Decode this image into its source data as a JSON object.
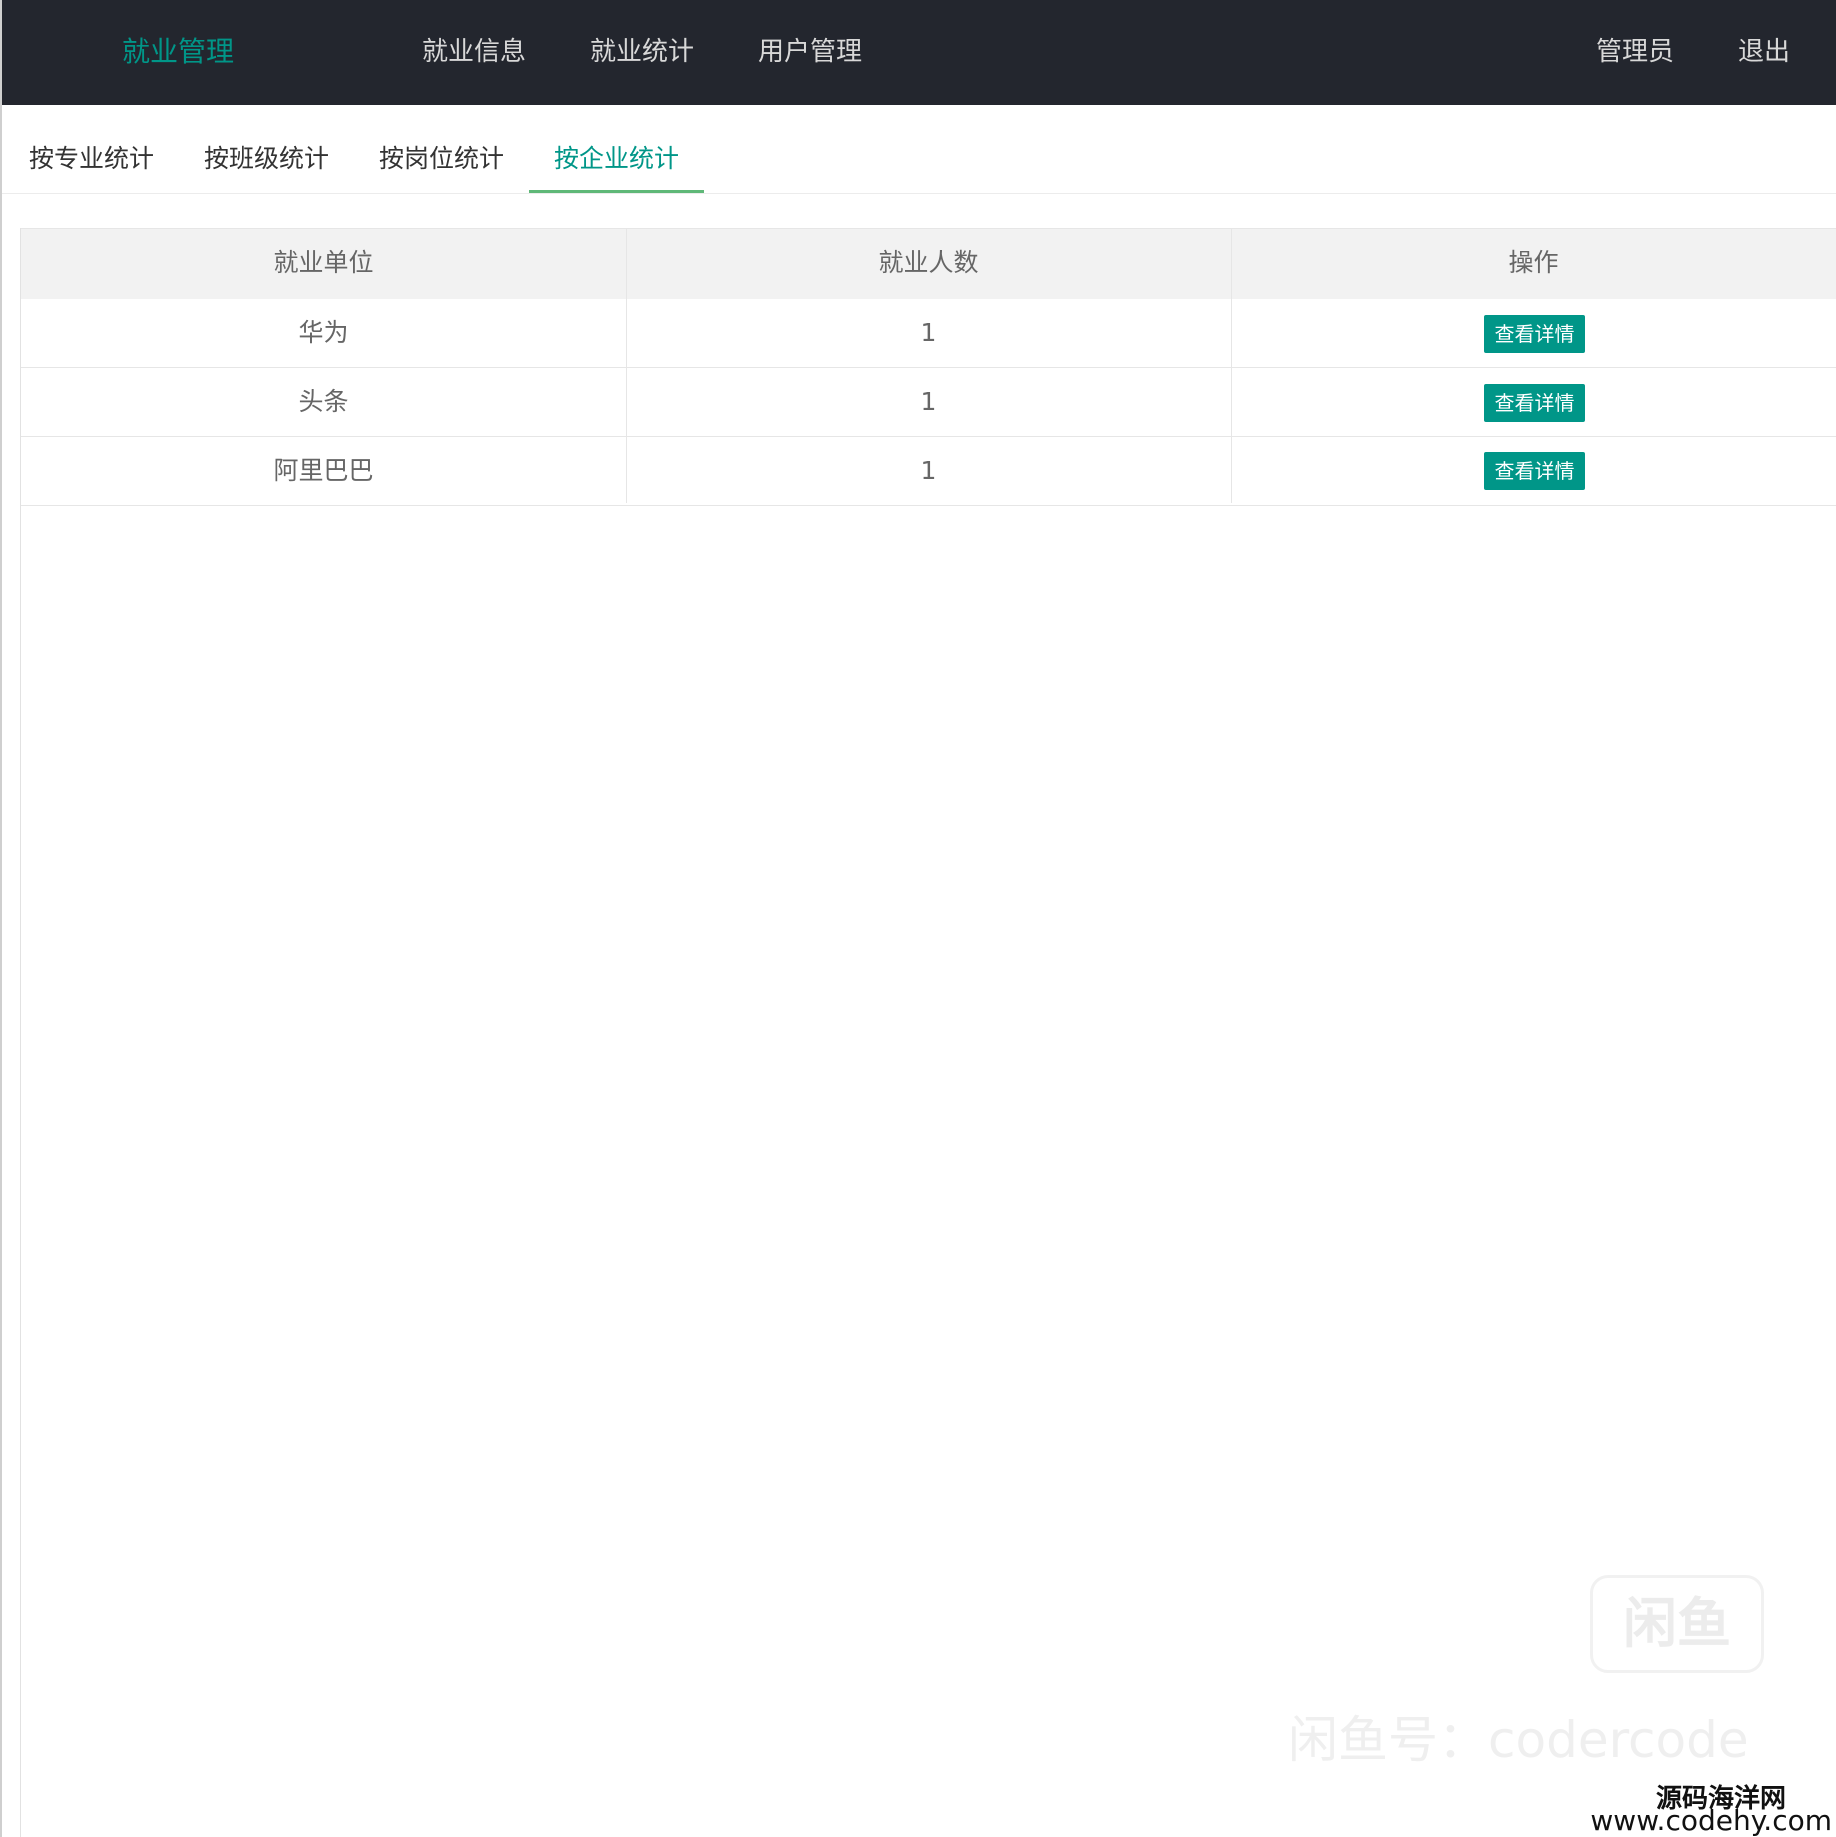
{
  "header": {
    "logo": "就业管理",
    "nav": [
      "就业信息",
      "就业统计",
      "用户管理"
    ],
    "user": "管理员",
    "logout": "退出"
  },
  "tabs": [
    "按专业统计",
    "按班级统计",
    "按岗位统计",
    "按企业统计"
  ],
  "active_tab": "按企业统计",
  "table": {
    "headers": [
      "就业单位",
      "就业人数",
      "操作"
    ],
    "rows": [
      {
        "company": "华为",
        "count": "1",
        "action": "查看详情"
      },
      {
        "company": "头条",
        "count": "1",
        "action": "查看详情"
      },
      {
        "company": "阿里巴巴",
        "count": "1",
        "action": "查看详情"
      }
    ]
  },
  "watermark": {
    "logo": "闲鱼",
    "text": "闲鱼号：codercode",
    "corner_line1": "源码海洋网",
    "corner_line2": "www.codehy.com"
  },
  "colors": {
    "header_bg": "#23262e",
    "accent": "#009688",
    "tab_underline": "#5fb878"
  }
}
